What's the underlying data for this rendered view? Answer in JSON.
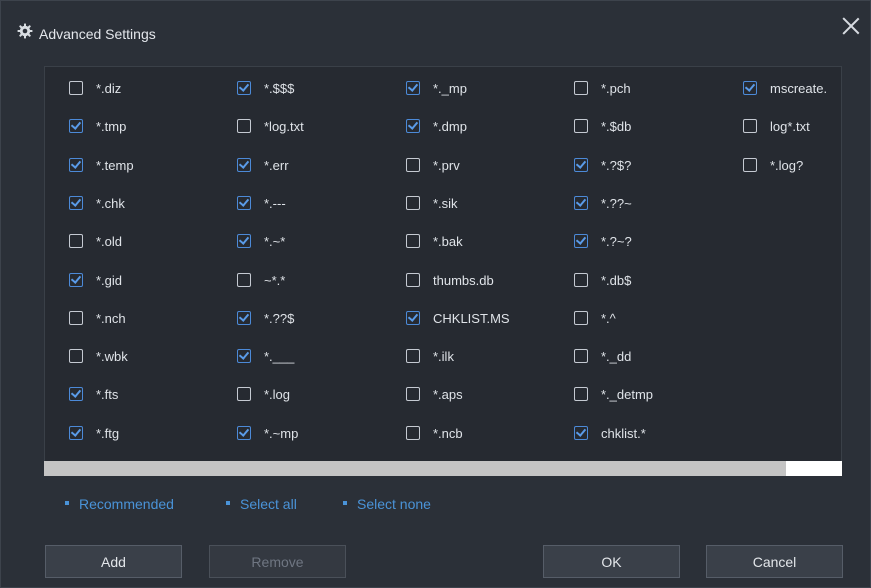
{
  "window": {
    "title": "Advanced Settings",
    "icon": "gear-icon",
    "close_icon": "close-icon"
  },
  "columns": [
    [
      {
        "label": "*.diz",
        "checked": false
      },
      {
        "label": "*.tmp",
        "checked": true
      },
      {
        "label": "*.temp",
        "checked": true
      },
      {
        "label": "*.chk",
        "checked": true
      },
      {
        "label": "*.old",
        "checked": false
      },
      {
        "label": "*.gid",
        "checked": true
      },
      {
        "label": "*.nch",
        "checked": false
      },
      {
        "label": "*.wbk",
        "checked": false
      },
      {
        "label": "*.fts",
        "checked": true
      },
      {
        "label": "*.ftg",
        "checked": true
      }
    ],
    [
      {
        "label": "*.$$$",
        "checked": true
      },
      {
        "label": "*log.txt",
        "checked": false
      },
      {
        "label": "*.err",
        "checked": true
      },
      {
        "label": "*.---",
        "checked": true
      },
      {
        "label": "*.~*",
        "checked": true
      },
      {
        "label": "~*.*",
        "checked": false
      },
      {
        "label": "*.??$",
        "checked": true
      },
      {
        "label": "*.___",
        "checked": true
      },
      {
        "label": "*.log",
        "checked": false
      },
      {
        "label": "*.~mp",
        "checked": true
      }
    ],
    [
      {
        "label": "*._mp",
        "checked": true
      },
      {
        "label": "*.dmp",
        "checked": true
      },
      {
        "label": "*.prv",
        "checked": false
      },
      {
        "label": "*.sik",
        "checked": false
      },
      {
        "label": "*.bak",
        "checked": false
      },
      {
        "label": "thumbs.db",
        "checked": false
      },
      {
        "label": "CHKLIST.MS",
        "checked": true
      },
      {
        "label": "*.ilk",
        "checked": false
      },
      {
        "label": "*.aps",
        "checked": false
      },
      {
        "label": "*.ncb",
        "checked": false
      }
    ],
    [
      {
        "label": "*.pch",
        "checked": false
      },
      {
        "label": "*.$db",
        "checked": false
      },
      {
        "label": "*.?$?",
        "checked": true
      },
      {
        "label": "*.??~",
        "checked": true
      },
      {
        "label": "*.?~?",
        "checked": true
      },
      {
        "label": "*.db$",
        "checked": false
      },
      {
        "label": "*.^",
        "checked": false
      },
      {
        "label": "*._dd",
        "checked": false
      },
      {
        "label": "*._detmp",
        "checked": false
      },
      {
        "label": "chklist.*",
        "checked": true
      }
    ],
    [
      {
        "label": "mscreate.",
        "checked": true
      },
      {
        "label": "log*.txt",
        "checked": false
      },
      {
        "label": "*.log?",
        "checked": false
      }
    ]
  ],
  "scrollbar": {
    "position_fraction": 0.0,
    "visible_fraction": 0.93
  },
  "links": {
    "recommended": "Recommended",
    "select_all": "Select all",
    "select_none": "Select none"
  },
  "buttons": {
    "add": "Add",
    "remove": "Remove",
    "ok": "OK",
    "cancel": "Cancel"
  },
  "colors": {
    "accent": "#4a93d8",
    "background": "#2b3038"
  }
}
